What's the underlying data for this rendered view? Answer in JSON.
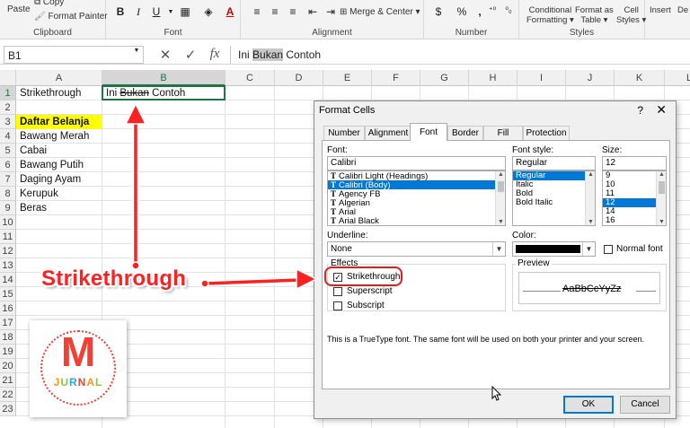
{
  "ribbon": {
    "clipboard": {
      "paste": "Paste",
      "copy": "Copy",
      "format_painter": "Format Painter",
      "label": "Clipboard"
    },
    "font": {
      "label": "Font",
      "bold": "B",
      "italic": "I",
      "underline": "U"
    },
    "alignment": {
      "merge_center": "Merge & Center",
      "label": "Alignment"
    },
    "number": {
      "currency": "$",
      "percent": "%",
      "comma": ",",
      "label": "Number"
    },
    "styles": {
      "conditional": "Conditional",
      "conditional2": "Formatting",
      "format_as": "Format as",
      "format_as2": "Table",
      "cell_styles": "Cell",
      "cell_styles2": "Styles",
      "label": "Styles"
    },
    "cells": {
      "insert": "Insert",
      "delete": "De"
    }
  },
  "formula_bar": {
    "name_box": "B1",
    "fx": "fx",
    "content_pre": "Ini ",
    "content_sel": "Bukan",
    "content_post": " Contoh"
  },
  "columns": [
    "A",
    "B",
    "C",
    "D",
    "E",
    "F",
    "G",
    "H",
    "I",
    "J",
    "K",
    "L"
  ],
  "rows": [
    "1",
    "2",
    "3",
    "4",
    "5",
    "6",
    "7",
    "8",
    "9",
    "10",
    "11",
    "12",
    "13",
    "14",
    "15",
    "16",
    "17",
    "18",
    "19",
    "20",
    "21",
    "22",
    "23"
  ],
  "cells": {
    "a1": "Strikethrough",
    "b1_pre": "Ini ",
    "b1_strike": "Bukan",
    "b1_post": " Contoh",
    "a3": "Daftar Belanja",
    "a4": "Bawang Merah",
    "a5": "Cabai",
    "a6": "Bawang Putih",
    "a7": "Daging Ayam",
    "a8": "Kerupuk",
    "a9": "Beras"
  },
  "dialog": {
    "title": "Format Cells",
    "help": "?",
    "close": "✕",
    "tabs": [
      "Number",
      "Alignment",
      "Font",
      "Border",
      "Fill",
      "Protection"
    ],
    "font_label": "Font:",
    "font_value": "Calibri",
    "font_list": [
      "Calibri Light (Headings)",
      "Calibri (Body)",
      "Agency FB",
      "Algerian",
      "Arial",
      "Arial Black"
    ],
    "style_label": "Font style:",
    "style_value": "Regular",
    "style_list": [
      "Regular",
      "Italic",
      "Bold",
      "Bold Italic"
    ],
    "size_label": "Size:",
    "size_value": "12",
    "size_list": [
      "9",
      "10",
      "11",
      "12",
      "14",
      "16"
    ],
    "underline_label": "Underline:",
    "underline_value": "None",
    "color_label": "Color:",
    "normal_font": "Normal font",
    "effects_label": "Effects",
    "strikethrough": "Strikethrough",
    "superscript": "Superscript",
    "subscript": "Subscript",
    "preview_label": "Preview",
    "preview_text": "AaBbCcYyZz",
    "info_text": "This is a TrueType font.  The same font will be used on both your printer and your screen.",
    "ok": "OK",
    "cancel": "Cancel"
  },
  "annotation": {
    "label": "Strikethrough"
  },
  "logo": {
    "letter": "M",
    "text": "JURNAL"
  },
  "colors": {
    "excel_green": "#217346",
    "accent_red": "#ff2020",
    "selection_blue": "#0078d7"
  }
}
